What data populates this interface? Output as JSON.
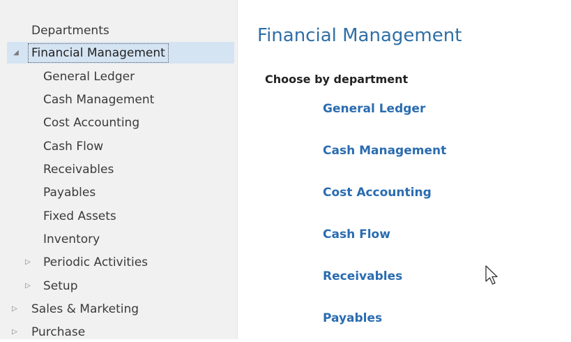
{
  "sidebar": {
    "header": "Departments",
    "items": [
      {
        "label": "Financial Management",
        "expander": "◢"
      },
      {
        "label": "General Ledger"
      },
      {
        "label": "Cash Management"
      },
      {
        "label": "Cost Accounting"
      },
      {
        "label": "Cash Flow"
      },
      {
        "label": "Receivables"
      },
      {
        "label": "Payables"
      },
      {
        "label": "Fixed Assets"
      },
      {
        "label": "Inventory"
      },
      {
        "label": "Periodic Activities",
        "expander": "▷"
      },
      {
        "label": "Setup",
        "expander": "▷"
      },
      {
        "label": "Sales & Marketing",
        "expander": "▷"
      },
      {
        "label": "Purchase",
        "expander": "▷"
      }
    ]
  },
  "main": {
    "title": "Financial Management",
    "section_label": "Choose by department",
    "links": [
      "General Ledger",
      "Cash Management",
      "Cost Accounting",
      "Cash Flow",
      "Receivables",
      "Payables"
    ]
  },
  "colors": {
    "accent": "#2a6cb0",
    "title": "#2f6fa6",
    "selection": "#d5e4f3",
    "sidebar_bg": "#f1f1f1"
  },
  "icons": {
    "expanded": "triangle-down-icon",
    "collapsed": "triangle-right-icon",
    "pointer": "mouse-cursor-icon"
  }
}
